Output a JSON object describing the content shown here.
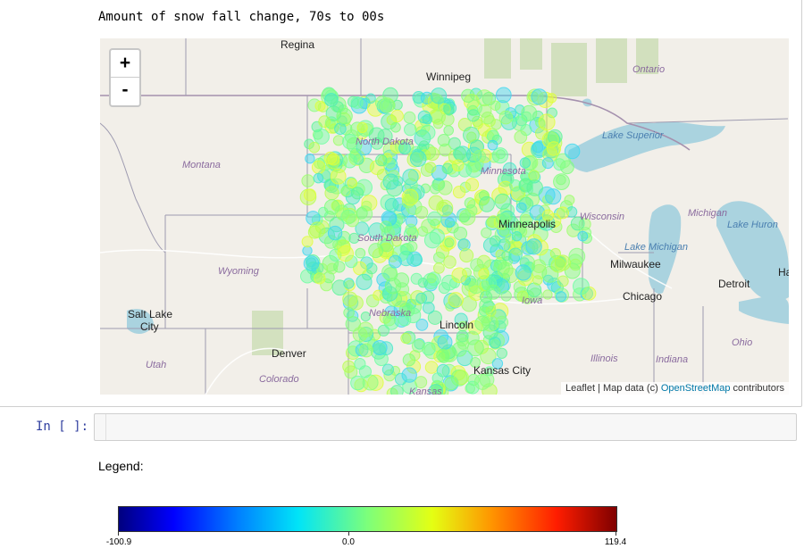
{
  "output": {
    "title": "Amount of snow fall change, 70s to 00s"
  },
  "map": {
    "zoom_in_label": "+",
    "zoom_out_label": "-",
    "attribution": {
      "prefix": "Leaflet | Map data (c) ",
      "link": "OpenStreetMap",
      "suffix": " contributors"
    },
    "cities": {
      "regina": "Regina",
      "winnipeg": "Winnipeg",
      "minneapolis": "Minneapolis",
      "milwaukee": "Milwaukee",
      "chicago": "Chicago",
      "detroit": "Detroit",
      "salt_lake_city_1": "Salt Lake",
      "salt_lake_city_2": "City",
      "denver": "Denver",
      "lincoln": "Lincoln",
      "kansas_city": "Kansas City",
      "ha": "Ha"
    },
    "states": {
      "montana": "Montana",
      "north_dakota": "North Dakota",
      "minnesota": "Minnesota",
      "south_dakota": "South Dakota",
      "wyoming": "Wyoming",
      "nebraska": "Nebraska",
      "wisconsin": "Wisconsin",
      "michigan": "Michigan",
      "iowa": "Iowa",
      "utah": "Utah",
      "colorado": "Colorado",
      "illinois": "Illinois",
      "indiana": "Indiana",
      "ohio": "Ohio",
      "kansas": "Kansas",
      "ontario": "Ontario"
    },
    "waters": {
      "lake_superior": "Lake Superior",
      "lake_michigan": "Lake Michigan",
      "lake_huron": "Lake Huron"
    },
    "colors": {
      "land": "#f2efe9",
      "water": "#aad3df",
      "park": "#c8dcb0",
      "border": "#9e9bb0",
      "road": "#ffffff"
    }
  },
  "cell": {
    "prompt": "In [ ]:",
    "value": ""
  },
  "legend": {
    "title": "Legend:",
    "min_label": "-100.9",
    "mid_label": "0.0",
    "max_label": "119.4",
    "min": -100.9,
    "max": 119.4,
    "colormap": "jet"
  }
}
